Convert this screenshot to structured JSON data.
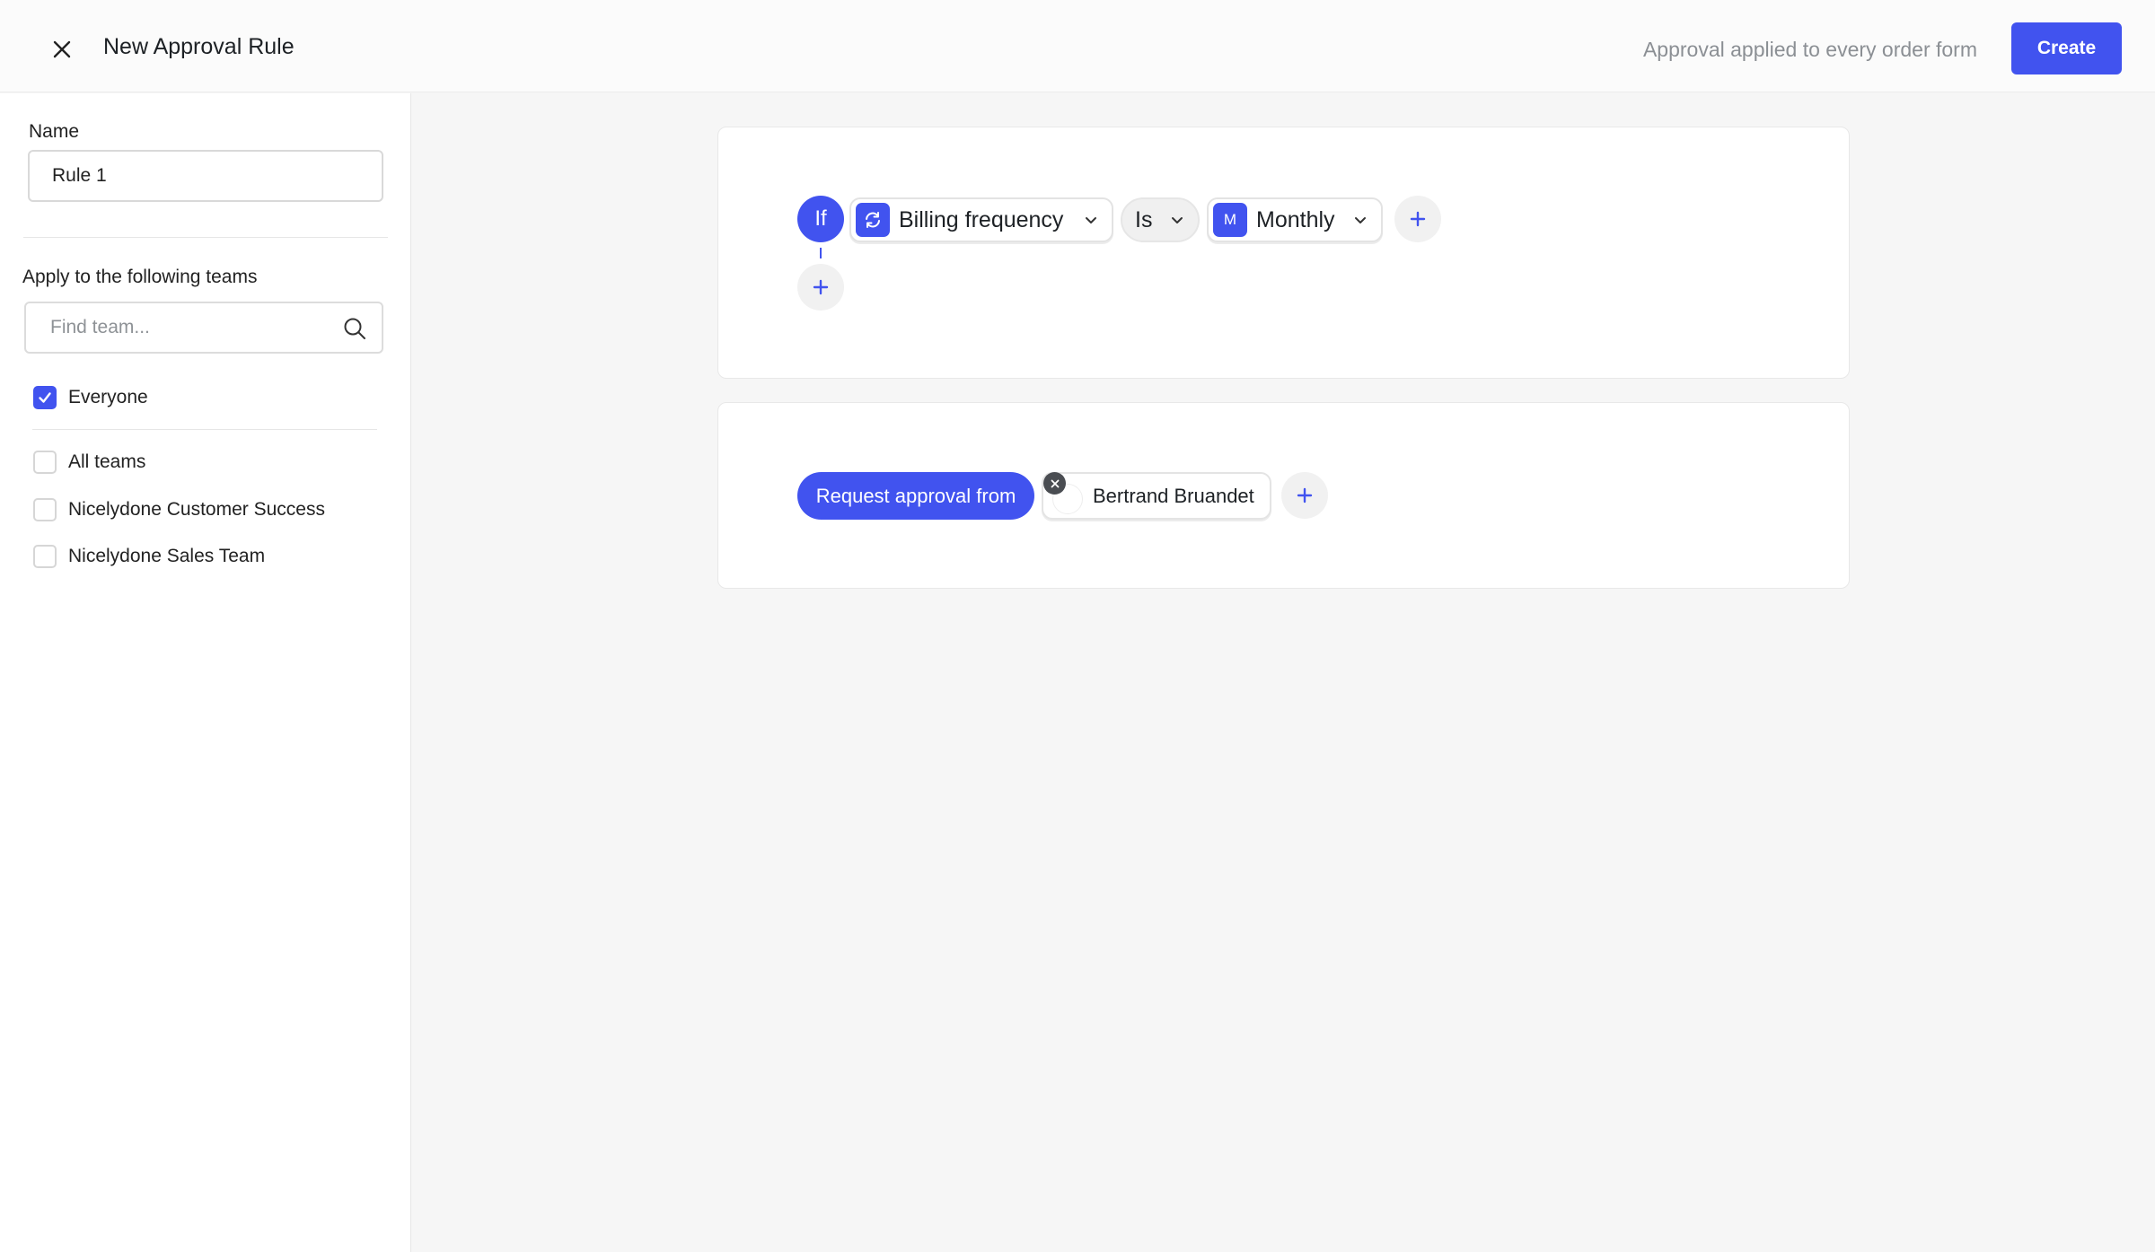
{
  "header": {
    "title": "New Approval Rule",
    "info": "Approval applied to every order form",
    "create_label": "Create"
  },
  "sidebar": {
    "name_label": "Name",
    "name_value": "Rule 1",
    "teams_label": "Apply to the following teams",
    "search_placeholder": "Find team...",
    "options": [
      {
        "label": "Everyone",
        "checked": true
      },
      {
        "label": "All teams",
        "checked": false
      },
      {
        "label": "Nicelydone Customer Success",
        "checked": false
      },
      {
        "label": "Nicelydone Sales Team",
        "checked": false
      }
    ]
  },
  "condition": {
    "if_label": "If",
    "field": "Billing frequency",
    "operator": "Is",
    "value_badge": "M",
    "value": "Monthly"
  },
  "approval": {
    "request_label": "Request approval from",
    "approver": "Bertrand Bruandet"
  },
  "colors": {
    "accent": "#4153ef",
    "background": "#f6f6f6"
  }
}
